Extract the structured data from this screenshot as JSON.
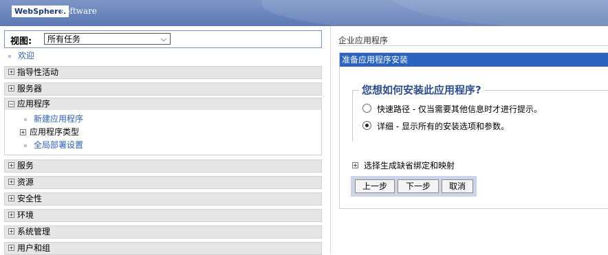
{
  "banner": {
    "logo": "WebSphere.",
    "product": "software"
  },
  "nav": {
    "view_label": "视图:",
    "view_value": "所有任务",
    "welcome": "欢迎",
    "sections_top": [
      "指导性活动",
      "服务器"
    ],
    "applications": {
      "label": "应用程序",
      "new_app": "新建应用程序",
      "app_types": "应用程序类型",
      "global_deploy": "全局部署设置"
    },
    "sections_bottom": [
      "服务",
      "资源",
      "安全性",
      "环境",
      "系统管理",
      "用户和组"
    ]
  },
  "content": {
    "breadcrumb": "企业应用程序",
    "title": "准备应用程序安装",
    "question": "您想如何安装此应用程序?",
    "option_fast": "快速路径  -  仅当需要其他信息时才进行提示。",
    "option_detailed": "详细  -  显示所有的安装选项和参数。",
    "selected_option": "detailed",
    "defaults_link": "选择生成缺省绑定和映射",
    "buttons": {
      "prev": "上一步",
      "next": "下一步",
      "cancel": "取消"
    }
  }
}
